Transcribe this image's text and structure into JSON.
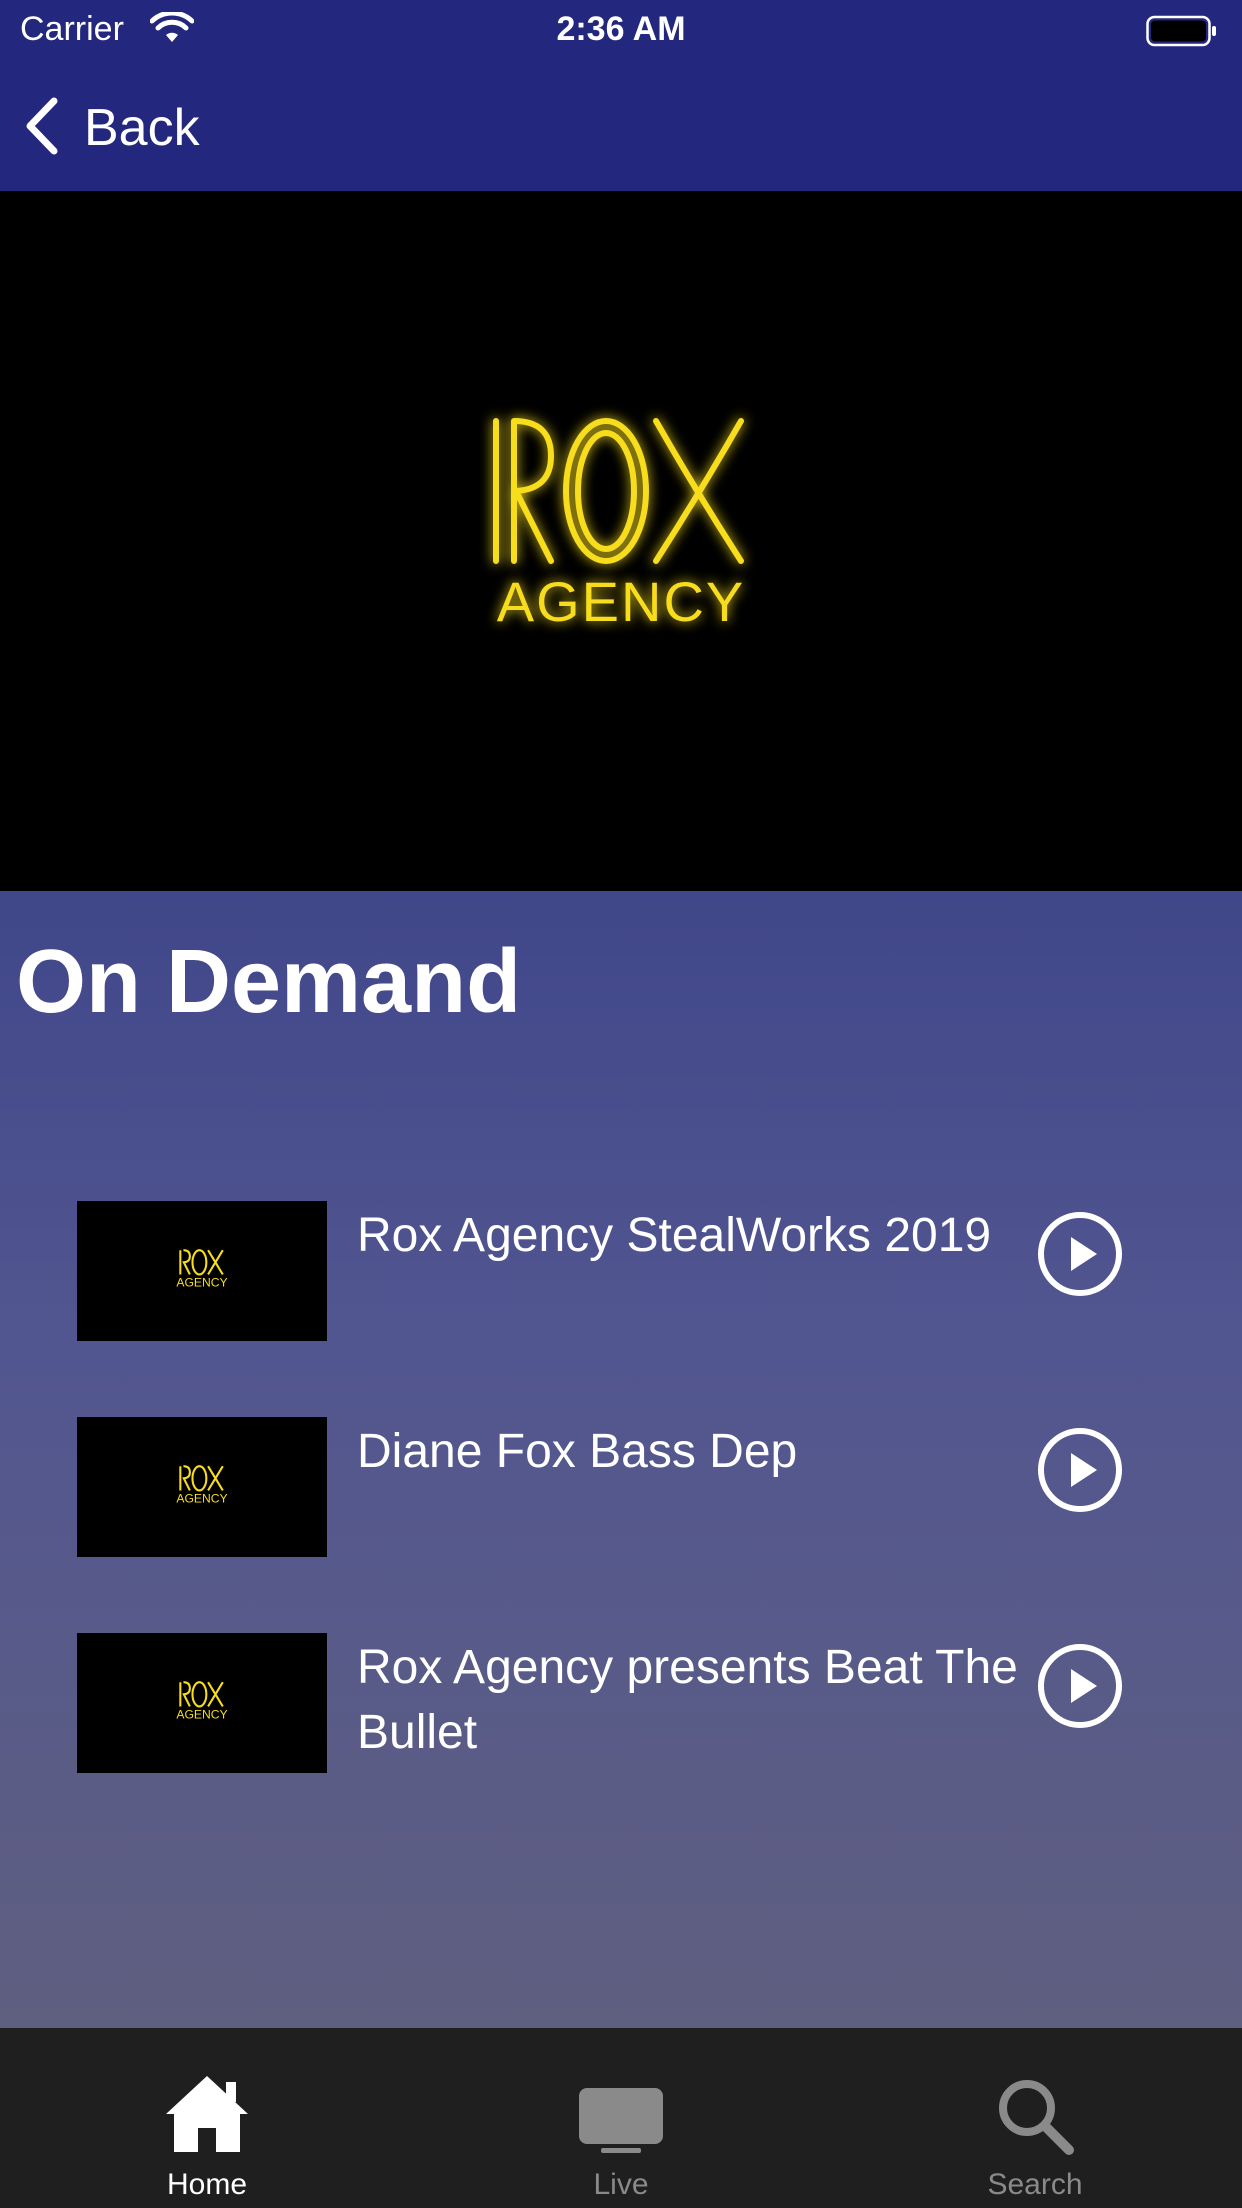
{
  "status_bar": {
    "carrier": "Carrier",
    "time": "2:36 AM"
  },
  "nav": {
    "back_label": "Back"
  },
  "hero": {
    "logo_text": "ROX AGENCY"
  },
  "main": {
    "title": "On Demand",
    "items": [
      {
        "title": "Rox Agency StealWorks 2019"
      },
      {
        "title": "Diane Fox Bass Dep"
      },
      {
        "title": "Rox Agency presents Beat The Bullet"
      }
    ]
  },
  "tabbar": {
    "tabs": [
      {
        "label": "Home",
        "icon": "home-icon",
        "selected": true
      },
      {
        "label": "Live",
        "icon": "tv-icon",
        "selected": false
      },
      {
        "label": "Search",
        "icon": "search-icon",
        "selected": false
      }
    ]
  },
  "colors": {
    "header": "#23287e",
    "logo_yellow": "#f7dd1b",
    "tab_selected": "#ffffff",
    "tab_unselected": "#8a8a8a"
  }
}
